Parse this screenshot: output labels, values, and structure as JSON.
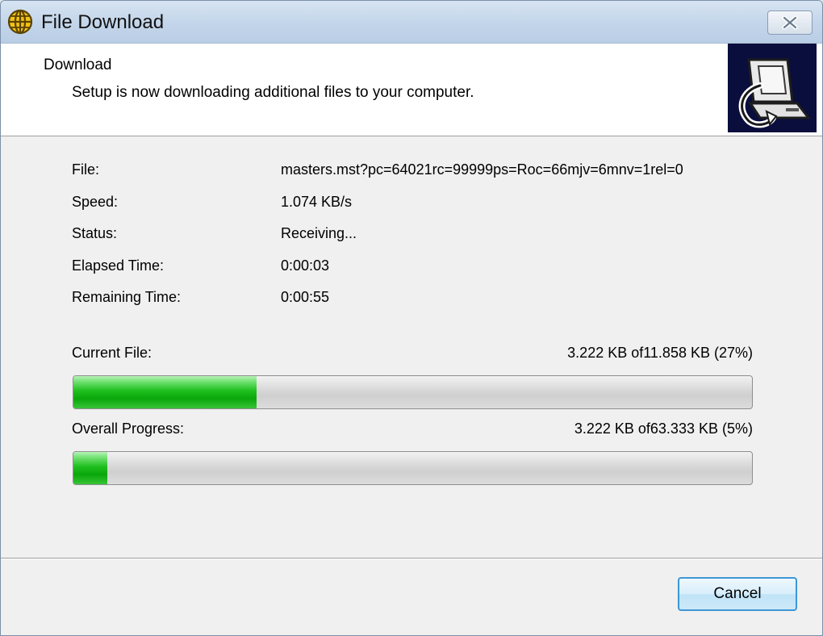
{
  "window": {
    "title": "File Download"
  },
  "header": {
    "title": "Download",
    "subtitle": "Setup is now downloading additional files to your computer."
  },
  "details": [
    {
      "label": "File:",
      "value": "masters.mst?pc=64021rc=99999ps=Roc=66mjv=6mnv=1rel=0"
    },
    {
      "label": "Speed:",
      "value": "1.074 KB/s"
    },
    {
      "label": "Status:",
      "value": "Receiving..."
    },
    {
      "label": "Elapsed Time:",
      "value": "0:00:03"
    },
    {
      "label": "Remaining Time:",
      "value": "0:00:55"
    }
  ],
  "current_file": {
    "label": "Current File:",
    "info": "3.222 KB of11.858 KB (27%)",
    "percent": 27
  },
  "overall": {
    "label": "Overall Progress:",
    "info": "3.222 KB of63.333 KB (5%)",
    "percent": 5
  },
  "buttons": {
    "cancel": "Cancel"
  },
  "colors": {
    "progress_green": "#14b814",
    "titlebar": "#c3d5ea",
    "cancel_border": "#3c97d6"
  },
  "icons": {
    "app": "globe-icon",
    "close": "close-icon",
    "header": "computer-download-icon"
  }
}
